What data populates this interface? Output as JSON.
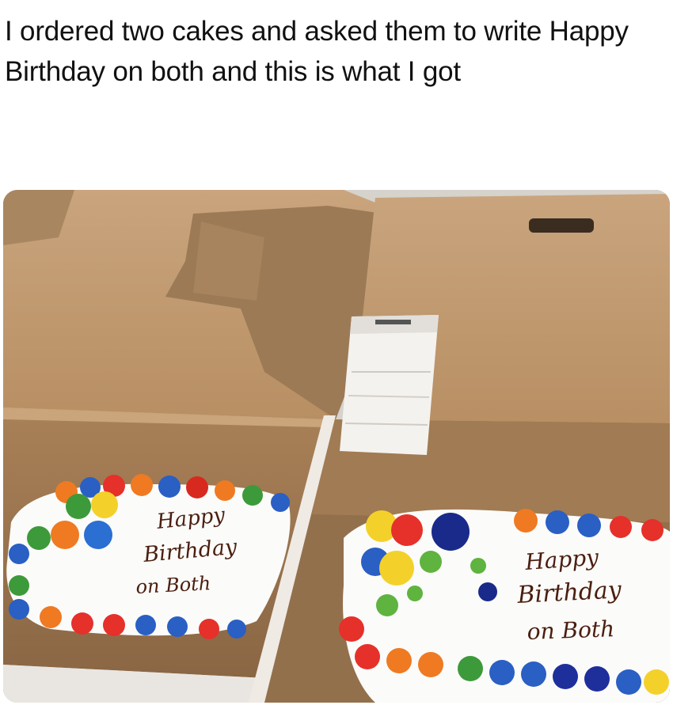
{
  "post": {
    "caption": "I ordered two cakes and asked them to write Happy Birthday on both and this is what I got"
  },
  "photo": {
    "left_cake": {
      "line1": "Happy",
      "line2": "Birthday",
      "line3": "on Both"
    },
    "right_cake": {
      "line1": "Happy",
      "line2": "Birthday",
      "line3": "on Both"
    }
  }
}
